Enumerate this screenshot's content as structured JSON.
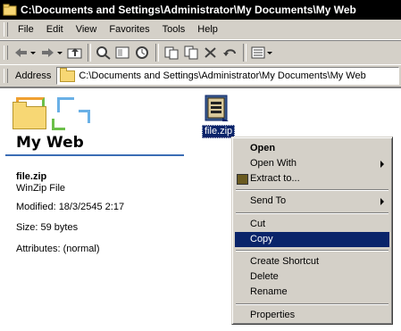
{
  "window": {
    "title": "C:\\Documents and Settings\\Administrator\\My Documents\\My Web"
  },
  "menubar": {
    "items": [
      "File",
      "Edit",
      "View",
      "Favorites",
      "Tools",
      "Help"
    ]
  },
  "toolbar": {
    "buttons": [
      "back-icon",
      "forward-icon",
      "up-folder-icon",
      "search-icon",
      "folders-icon",
      "history-icon",
      "move-to-icon",
      "copy-to-icon",
      "delete-icon",
      "undo-icon",
      "views-icon"
    ]
  },
  "address": {
    "label": "Address",
    "value": "C:\\Documents and Settings\\Administrator\\My Documents\\My Web"
  },
  "webview": {
    "folder_title": "My Web",
    "file_name": "file.zip",
    "file_type": "WinZip File",
    "modified": "Modified: 18/3/2545 2:17",
    "size": "Size: 59 bytes",
    "attributes": "Attributes: (normal)"
  },
  "file": {
    "label": "file.zip",
    "icon": "winzip-file-icon"
  },
  "context_menu": {
    "items": [
      "Open",
      "Open With",
      "Extract to...",
      "Send To",
      "Cut",
      "Copy",
      "Create Shortcut",
      "Delete",
      "Rename",
      "Properties"
    ],
    "selected": "Copy"
  },
  "colors": {
    "selection": "#0a246a",
    "face": "#d4d0c8",
    "rule": "#3b6db5"
  }
}
